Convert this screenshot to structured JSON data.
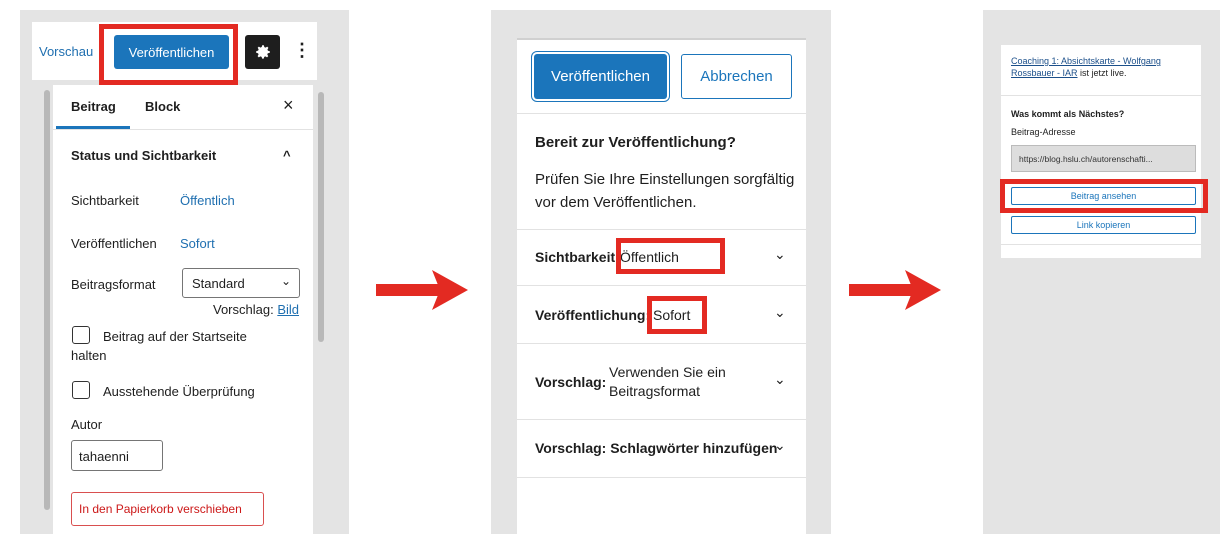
{
  "panel1": {
    "preview_label": "Vorschau",
    "publish_label": "Veröffentlichen",
    "more_glyph": "⋮",
    "tabs": [
      "Beitrag",
      "Block"
    ],
    "close_glyph": "×",
    "section_title": "Status und Sichtbarkeit",
    "collapse_glyph": "^",
    "visibility_label": "Sichtbarkeit",
    "visibility_value": "Öffentlich",
    "publish_row_label": "Veröffentlichen",
    "publish_row_value": "Sofort",
    "format_label": "Beitragsformat",
    "format_value": "Standard",
    "suggestion_prefix": "Vorschlag:",
    "suggestion_link": "Bild",
    "sticky_label_1": "Beitrag auf der Startseite",
    "sticky_label_2": "halten",
    "pending_label": "Ausstehende Überprüfung",
    "author_label": "Autor",
    "author_value": "tahaenni",
    "trash_label": "In den Papierkorb verschieben"
  },
  "panel2": {
    "publish_label": "Veröffentlichen",
    "cancel_label": "Abbrechen",
    "heading": "Bereit zur Veröffentlichung?",
    "desc_line1": "Prüfen Sie Ihre Einstellungen sorgfältig",
    "desc_line2": "vor dem Veröffentlichen.",
    "visibility_label": "Sichtbarkeit:",
    "visibility_value": "Öffentlich",
    "publish_label_row": "Veröffentlichung:",
    "publish_value": "Sofort",
    "suggestion_label": "Vorschlag:",
    "suggestion_value_1": "Verwenden Sie ein",
    "suggestion_value_2": "Beitragsformat",
    "tags_label": "Vorschlag: Schlagwörter hinzufügen"
  },
  "panel3": {
    "live_link_1": "Coaching 1: Absichtskarte - Wolfgang",
    "live_link_2": "Rossbauer - IAR",
    "live_suffix": " ist jetzt live.",
    "next_heading": "Was kommt als Nächstes?",
    "address_label": "Beitrag-Adresse",
    "address_value": "https://blog.hslu.ch/autorenschafti...",
    "view_label": "Beitrag ansehen",
    "copy_label": "Link kopieren"
  },
  "colors": {
    "accent": "#1b75bb",
    "highlight": "#e32a22",
    "panel_bg": "#e4e4e4"
  }
}
